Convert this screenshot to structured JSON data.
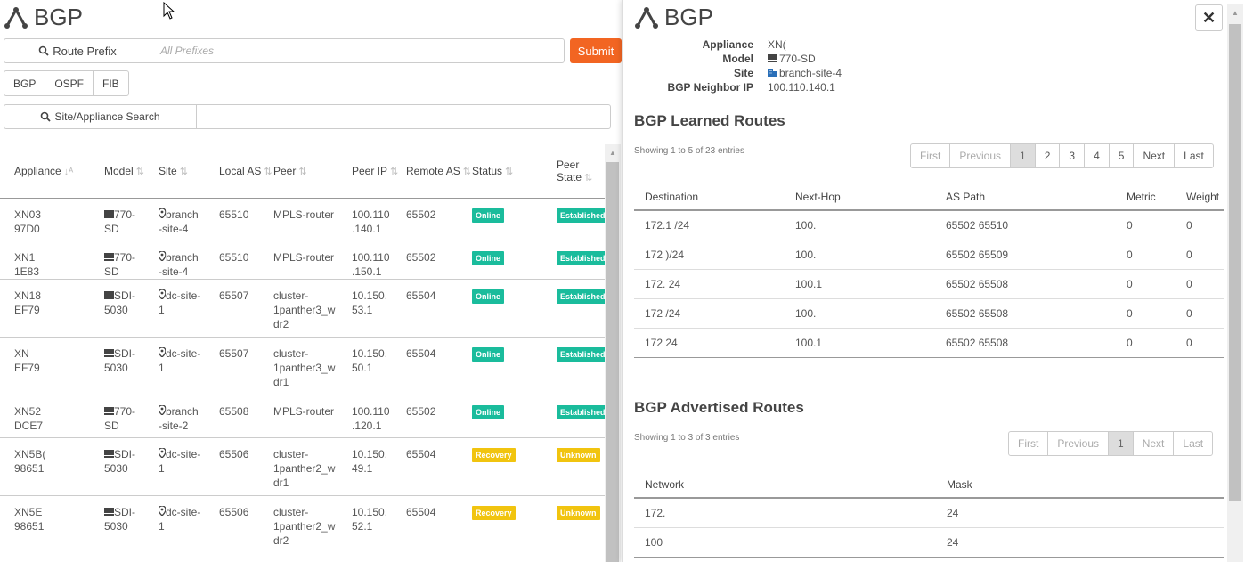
{
  "page": {
    "title": "BGP",
    "route_prefix_label": "Route Prefix",
    "route_prefix_placeholder": "All Prefixes",
    "submit_label": "Submit",
    "tabs": [
      "BGP",
      "OSPF",
      "FIB"
    ],
    "site_search_label": "Site/Appliance Search"
  },
  "table": {
    "headers": [
      "Appliance",
      "Model",
      "Site",
      "Local AS",
      "Peer",
      "Peer IP",
      "Remote AS",
      "Status",
      "Peer State"
    ],
    "rows": [
      {
        "appliance": [
          "XN03",
          "97D0"
        ],
        "model": [
          "770-",
          "SD"
        ],
        "model_icon": "appliance-icon",
        "site": [
          "branch",
          "-site-4"
        ],
        "local_as": "65510",
        "peer": [
          "MPLS-router"
        ],
        "peer_ip": [
          "100.110",
          ".140.1"
        ],
        "remote_as": "65502",
        "status": "Online",
        "peer_state": "Established",
        "sep": false
      },
      {
        "appliance": [
          "XN1",
          "1E83"
        ],
        "model": [
          "770-",
          "SD"
        ],
        "model_icon": "appliance-icon",
        "site": [
          "branch",
          "-site-4"
        ],
        "local_as": "65510",
        "peer": [
          "MPLS-router"
        ],
        "peer_ip": [
          "100.110",
          ".150.1"
        ],
        "remote_as": "65502",
        "status": "Online",
        "peer_state": "Established",
        "sep": false
      },
      {
        "appliance": [
          "XN18",
          "EF79"
        ],
        "model": [
          "SDI-",
          "5030"
        ],
        "model_icon": "appliance-icon",
        "site": [
          "dc-site-",
          "1"
        ],
        "local_as": "65507",
        "peer": [
          "cluster-",
          "1panther3_w",
          "dr2"
        ],
        "peer_ip": [
          "10.150.",
          "53.1"
        ],
        "remote_as": "65504",
        "status": "Online",
        "peer_state": "Established",
        "sep": true
      },
      {
        "appliance": [
          "XN",
          "EF79"
        ],
        "model": [
          "SDI-",
          "5030"
        ],
        "model_icon": "appliance-icon",
        "site": [
          "dc-site-",
          "1"
        ],
        "local_as": "65507",
        "peer": [
          "cluster-",
          "1panther3_w",
          "dr1"
        ],
        "peer_ip": [
          "10.150.",
          "50.1"
        ],
        "remote_as": "65504",
        "status": "Online",
        "peer_state": "Established",
        "sep": true
      },
      {
        "appliance": [
          "XN52",
          "DCE7"
        ],
        "model": [
          "770-",
          "SD"
        ],
        "model_icon": "appliance-icon",
        "site": [
          "branch",
          "-site-2"
        ],
        "local_as": "65508",
        "peer": [
          "MPLS-router"
        ],
        "peer_ip": [
          "100.110",
          ".120.1"
        ],
        "remote_as": "65502",
        "status": "Online",
        "peer_state": "Established",
        "sep": false
      },
      {
        "appliance": [
          "XN5B(",
          "98651"
        ],
        "model": [
          "SDI-",
          "5030"
        ],
        "model_icon": "appliance-icon",
        "site": [
          "dc-site-",
          "1"
        ],
        "local_as": "65506",
        "peer": [
          "cluster-",
          "1panther2_w",
          "dr1"
        ],
        "peer_ip": [
          "10.150.",
          "49.1"
        ],
        "remote_as": "65504",
        "status": "Recovery",
        "peer_state": "Unknown",
        "sep": true
      },
      {
        "appliance": [
          "XN5E",
          "98651"
        ],
        "model": [
          "SDI-",
          "5030"
        ],
        "model_icon": "appliance-icon",
        "site": [
          "dc-site-",
          "1"
        ],
        "local_as": "65506",
        "peer": [
          "cluster-",
          "1panther2_w",
          "dr2"
        ],
        "peer_ip": [
          "10.150.",
          "52.1"
        ],
        "remote_as": "65504",
        "status": "Recovery",
        "peer_state": "Unknown",
        "sep": true
      }
    ]
  },
  "panel": {
    "title": "BGP",
    "close_icon": "close-icon",
    "info": [
      {
        "key": "Appliance",
        "value": "XN(",
        "icon": ""
      },
      {
        "key": "Model",
        "value": "770-SD",
        "icon": "appliance-icon"
      },
      {
        "key": "Site",
        "value": "branch-site-4",
        "icon": "building-icon"
      },
      {
        "key": "BGP Neighbor IP",
        "value": "100.110.140.1",
        "icon": ""
      }
    ],
    "learned": {
      "title": "BGP Learned Routes",
      "showing": "Showing 1 to 5 of 23 entries",
      "pager": [
        "First",
        "Previous",
        "1",
        "2",
        "3",
        "4",
        "5",
        "Next",
        "Last"
      ],
      "headers": [
        "Destination",
        "Next-Hop",
        "AS Path",
        "Metric",
        "Weight"
      ],
      "rows": [
        [
          "172.1        /24",
          "100.",
          "65502 65510",
          "0",
          "0"
        ],
        [
          "172        )/24",
          "100.",
          "65502 65509",
          "0",
          "0"
        ],
        [
          "172.         24",
          "100.1",
          "65502 65508",
          "0",
          "0"
        ],
        [
          "172        /24",
          "100.",
          "65502 65508",
          "0",
          "0"
        ],
        [
          "172         24",
          "100.1",
          "65502 65508",
          "0",
          "0"
        ]
      ]
    },
    "advertised": {
      "title": "BGP Advertised Routes",
      "showing": "Showing 1 to 3 of 3 entries",
      "pager": [
        "First",
        "Previous",
        "1",
        "Next",
        "Last"
      ],
      "headers": [
        "Network",
        "Mask"
      ],
      "rows": [
        [
          "172.",
          "24"
        ],
        [
          "100",
          "24"
        ]
      ]
    }
  },
  "colors": {
    "accent": "#f26522",
    "online": "#1abc9c",
    "recovery": "#f1c40f",
    "link": "#2a6fb8"
  }
}
